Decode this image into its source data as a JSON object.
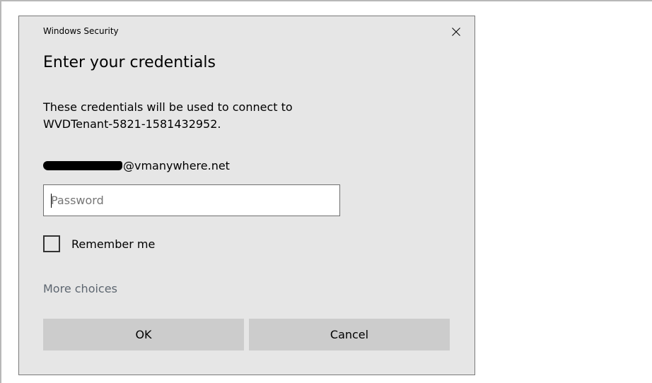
{
  "window": {
    "title": "Windows Security",
    "close_icon": "close-icon"
  },
  "dialog": {
    "heading": "Enter your credentials",
    "message_line1": "These credentials will be used to connect to",
    "message_line2": "WVDTenant-5821-1581432952.",
    "account_domain": "@vmanywhere.net",
    "password": {
      "value": "",
      "placeholder": "Password"
    },
    "remember_me": {
      "label": "Remember me",
      "checked": false
    },
    "more_choices": "More choices",
    "ok_label": "OK",
    "cancel_label": "Cancel"
  },
  "colors": {
    "dialog_bg": "#e6e6e6",
    "button_bg": "#cccccc",
    "link_text": "#5d6670"
  }
}
